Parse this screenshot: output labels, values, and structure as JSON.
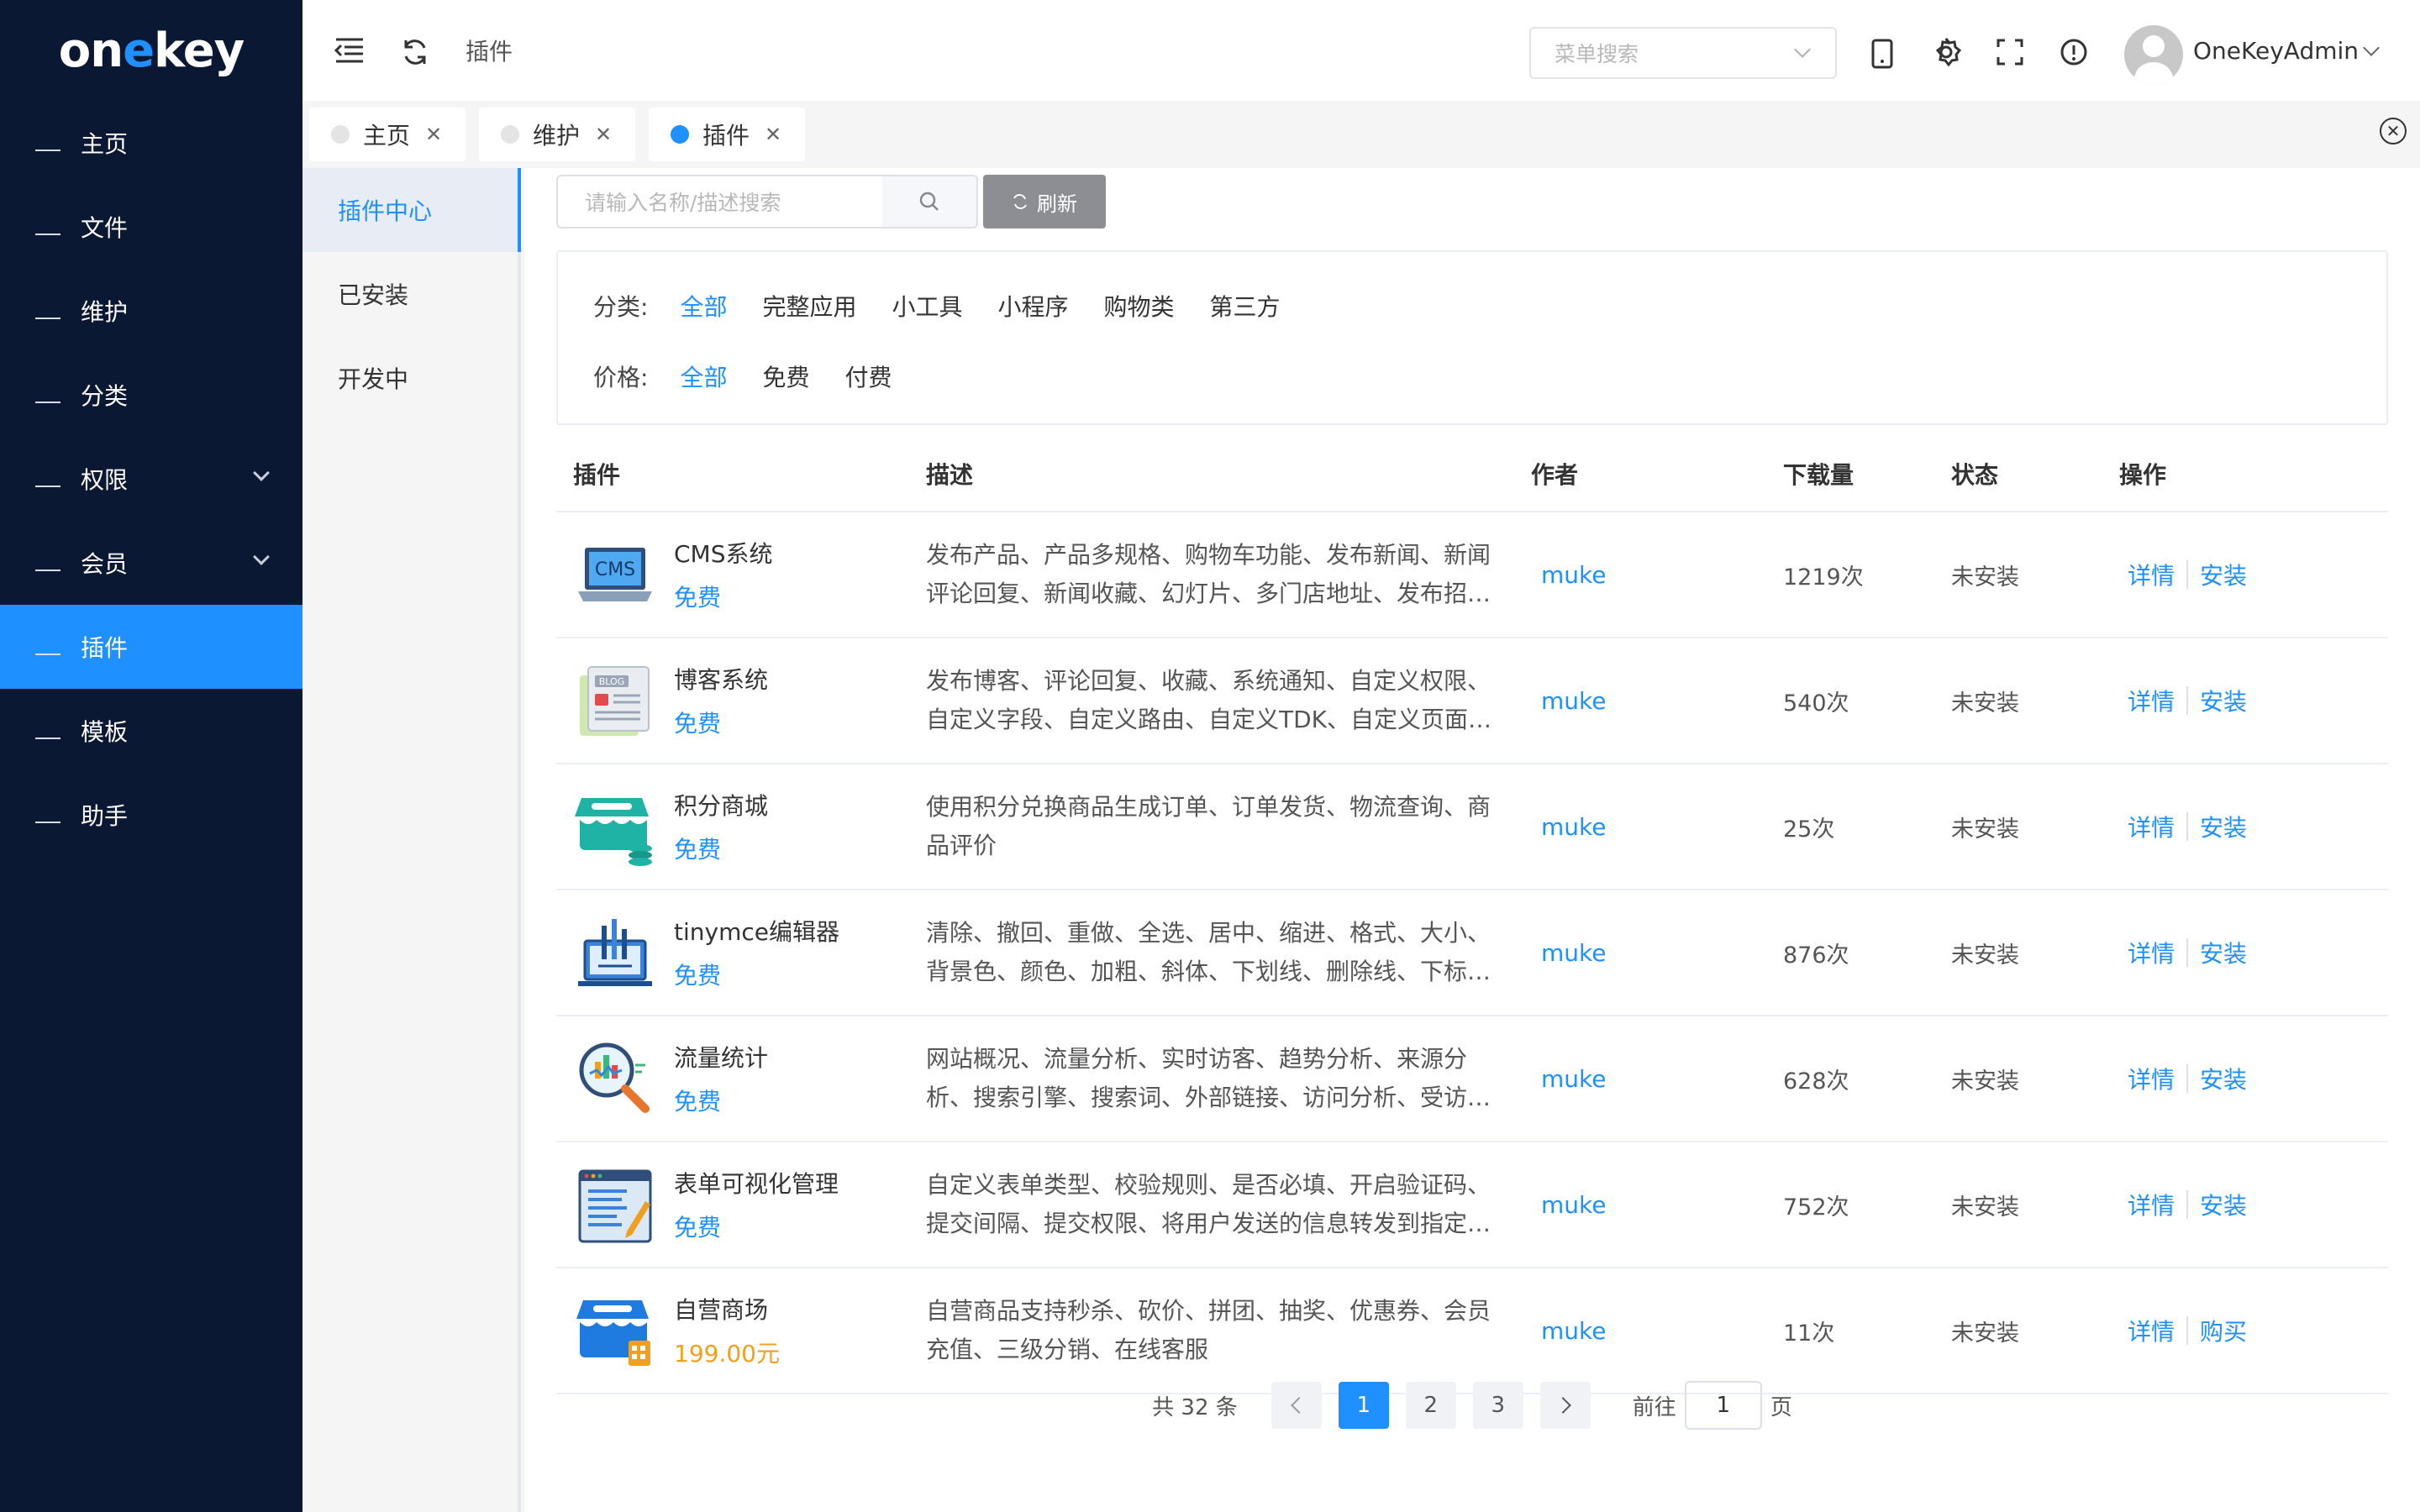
{
  "app": {
    "logo_pre": "on",
    "logo_e": "e",
    "logo_post": "key"
  },
  "sidebar": {
    "items": [
      {
        "label": "主页",
        "has_children": false
      },
      {
        "label": "文件",
        "has_children": false
      },
      {
        "label": "维护",
        "has_children": false
      },
      {
        "label": "分类",
        "has_children": false
      },
      {
        "label": "权限",
        "has_children": true
      },
      {
        "label": "会员",
        "has_children": true
      },
      {
        "label": "插件",
        "has_children": false,
        "active": true
      },
      {
        "label": "模板",
        "has_children": false
      },
      {
        "label": "助手",
        "has_children": false
      }
    ]
  },
  "header": {
    "breadcrumb": "插件",
    "menu_search_placeholder": "菜单搜索",
    "username": "OneKeyAdmin",
    "icons": [
      "menu-fold-icon",
      "refresh-icon",
      "mobile-icon",
      "settings-icon",
      "fullscreen-icon",
      "info-icon"
    ]
  },
  "tabs": [
    {
      "label": "主页",
      "active": false
    },
    {
      "label": "维护",
      "active": false
    },
    {
      "label": "插件",
      "active": true
    }
  ],
  "subnav": {
    "items": [
      {
        "label": "插件中心",
        "active": true
      },
      {
        "label": "已安装",
        "active": false
      },
      {
        "label": "开发中",
        "active": false
      }
    ]
  },
  "toolbar": {
    "search_placeholder": "请输入名称/描述搜索",
    "refresh_label": "刷新"
  },
  "filters": {
    "category": {
      "label": "分类:",
      "options": [
        "全部",
        "完整应用",
        "小工具",
        "小程序",
        "购物类",
        "第三方"
      ],
      "selected": "全部"
    },
    "price": {
      "label": "价格:",
      "options": [
        "全部",
        "免费",
        "付费"
      ],
      "selected": "全部"
    }
  },
  "table": {
    "headers": [
      "插件",
      "描述",
      "作者",
      "下载量",
      "状态",
      "操作"
    ],
    "rows": [
      {
        "icon": "cms-laptop-icon",
        "name": "CMS系统",
        "price": "免费",
        "paid": false,
        "desc": "发布产品、产品多规格、购物车功能、发布新闻、新闻评论回复、新闻收藏、幻灯片、多门店地址、发布招…",
        "author": "muke",
        "downloads": "1219次",
        "status": "未安装",
        "op1": "详情",
        "op2": "安装"
      },
      {
        "icon": "blog-icon",
        "name": "博客系统",
        "price": "免费",
        "paid": false,
        "desc": "发布博客、评论回复、收藏、系统通知、自定义权限、自定义字段、自定义路由、自定义TDK、自定义页面…",
        "author": "muke",
        "downloads": "540次",
        "status": "未安装",
        "op1": "详情",
        "op2": "安装"
      },
      {
        "icon": "points-mall-icon",
        "name": "积分商城",
        "price": "免费",
        "paid": false,
        "desc": "使用积分兑换商品生成订单、订单发货、物流查询、商品评价",
        "author": "muke",
        "downloads": "25次",
        "status": "未安装",
        "op1": "详情",
        "op2": "安装"
      },
      {
        "icon": "editor-icon",
        "name": "tinymce编辑器",
        "price": "免费",
        "paid": false,
        "desc": "清除、撤回、重做、全选、居中、缩进、格式、大小、背景色、颜色、加粗、斜体、下划线、删除线、下标…",
        "author": "muke",
        "downloads": "876次",
        "status": "未安装",
        "op1": "详情",
        "op2": "安装"
      },
      {
        "icon": "analytics-icon",
        "name": "流量统计",
        "price": "免费",
        "paid": false,
        "desc": "网站概况、流量分析、实时访客、趋势分析、来源分析、搜索引擎、搜索词、外部链接、访问分析、受访…",
        "author": "muke",
        "downloads": "628次",
        "status": "未安装",
        "op1": "详情",
        "op2": "安装"
      },
      {
        "icon": "form-icon",
        "name": "表单可视化管理",
        "price": "免费",
        "paid": false,
        "desc": "自定义表单类型、校验规则、是否必填、开启验证码、提交间隔、提交权限、将用户发送的信息转发到指定…",
        "author": "muke",
        "downloads": "752次",
        "status": "未安装",
        "op1": "详情",
        "op2": "安装"
      },
      {
        "icon": "store-icon",
        "name": "自营商场",
        "price": "199.00元",
        "paid": true,
        "desc": "自营商品支持秒杀、砍价、拼团、抽奖、优惠券、会员充值、三级分销、在线客服",
        "author": "muke",
        "downloads": "11次",
        "status": "未安装",
        "op1": "详情",
        "op2": "购买"
      }
    ]
  },
  "pagination": {
    "total_text": "共 32 条",
    "pages": [
      "1",
      "2",
      "3"
    ],
    "current": "1",
    "goto_label": "前往",
    "goto_value": "1",
    "page_suffix": "页"
  },
  "colors": {
    "sidebar_bg": "#0b1833",
    "accent": "#1e90ff",
    "paid": "#f0a020"
  }
}
